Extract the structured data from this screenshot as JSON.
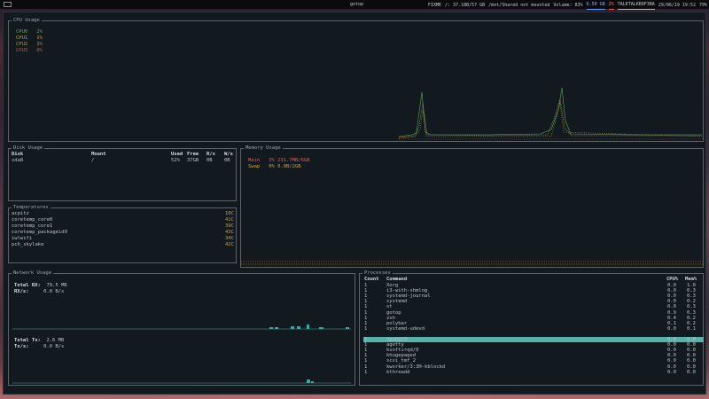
{
  "topbar": {
    "workspace": "",
    "title": "gotop",
    "segments": [
      {
        "text": "FIXME"
      },
      {
        "text": "/: 37.18B/57 GB"
      },
      {
        "text": "/mnt/Shared not mounted"
      },
      {
        "text": "Volume: 83%"
      },
      {
        "text": "0.50 GB",
        "style": "blue"
      },
      {
        "text": "2%",
        "style": "red"
      },
      {
        "text": "TALKTALKB9F3BA"
      },
      {
        "text": "29/06/19 19:52"
      },
      {
        "text": "79%"
      }
    ]
  },
  "cpu": {
    "title": "CPU Usage",
    "legend": [
      {
        "label": "CPU0",
        "value": "2%",
        "color": "#5fa56a"
      },
      {
        "label": "CPU1",
        "value": "1%",
        "color": "#c8a23a"
      },
      {
        "label": "CPU2",
        "value": "1%",
        "color": "#a3a03a"
      },
      {
        "label": "CPU3",
        "value": "0%",
        "color": "#c05a4a"
      }
    ]
  },
  "disk": {
    "title": "Disk Usage",
    "headers": [
      "Disk",
      "Mount",
      "Used",
      "Free",
      "R/s",
      "W/s"
    ],
    "rows": [
      [
        "sda8",
        "/",
        "52%",
        "37GB",
        "0B",
        "0B"
      ]
    ]
  },
  "memory": {
    "title": "Memory Usage",
    "main": {
      "label": "Main",
      "value": "3% 231.7MB/6GB"
    },
    "swap": {
      "label": "Swap",
      "value": "0% 0.0B/2GB"
    }
  },
  "temps": {
    "title": "Temperatures",
    "rows": [
      {
        "name": "acpitz",
        "value": "10C"
      },
      {
        "name": "coretemp_core0",
        "value": "41C"
      },
      {
        "name": "coretemp_core1",
        "value": "39C"
      },
      {
        "name": "coretemp_packageid0",
        "value": "43C"
      },
      {
        "name": "iwlwifi",
        "value": "34C"
      },
      {
        "name": "pch_skylake",
        "value": "42C"
      }
    ]
  },
  "network": {
    "title": "Network Usage",
    "rx_total_label": "Total RX:",
    "rx_total": "79.5 MB",
    "rx_rate_label": "RX/s:",
    "rx_rate": "0.0 B/s",
    "tx_total_label": "Total Tx:",
    "tx_total": "2.6 MB",
    "tx_rate_label": "Tx/s:",
    "tx_rate": "0.0 B/s"
  },
  "processes": {
    "title": "Processes",
    "headers": [
      "Count",
      "Command",
      "CPU%",
      "Mem%"
    ],
    "selected_index": 9,
    "rows": [
      [
        "1",
        "Xorg",
        "0.0",
        "1.0"
      ],
      [
        "1",
        "i3-with-shmlog",
        "0.0",
        "0.3"
      ],
      [
        "1",
        "systemd-journal",
        "0.0",
        "0.3"
      ],
      [
        "1",
        "systemd",
        "0.0",
        "0.2"
      ],
      [
        "1",
        "st",
        "0.0",
        "0.3"
      ],
      [
        "1",
        "gotop",
        "0.9",
        "0.3"
      ],
      [
        "1",
        "zsh",
        "0.4",
        "0.2"
      ],
      [
        "1",
        "polybar",
        "0.1",
        "0.2"
      ],
      [
        "1",
        "systemd-udevd",
        "0.0",
        "0.1"
      ],
      [
        "1",
        "",
        "",
        ""
      ],
      [
        "1",
        "cpuhp/3",
        "0.0",
        "0.0"
      ],
      [
        "1",
        "agetty",
        "0.0",
        "0.0"
      ],
      [
        "1",
        "ksoftirqd/0",
        "0.0",
        "0.0"
      ],
      [
        "1",
        "khugepaged",
        "0.0",
        "0.0"
      ],
      [
        "1",
        "scsi_tmf_2",
        "0.0",
        "0.0"
      ],
      [
        "1",
        "kworker/3:3H-kblockd",
        "0.0",
        "0.0"
      ],
      [
        "1",
        "kthreadd",
        "0.0",
        "0.0"
      ]
    ]
  }
}
